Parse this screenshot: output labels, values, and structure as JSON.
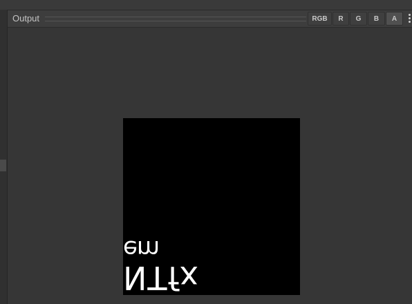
{
  "panel": {
    "title": "Output"
  },
  "channels": [
    {
      "label": "RGB",
      "active": false
    },
    {
      "label": "R",
      "active": false
    },
    {
      "label": "G",
      "active": false
    },
    {
      "label": "B",
      "active": false
    },
    {
      "label": "A",
      "active": true
    }
  ],
  "preview": {
    "text_line_1": "em",
    "text_line_2": "NTfx",
    "background_color": "#000000",
    "text_color": "#ffffff"
  },
  "icons": {
    "menu": "vertical-ellipsis-icon"
  },
  "colors": {
    "panel_bg": "#353535",
    "header_bg": "#3d3d3d",
    "button_bg": "#3f3f3f",
    "button_active_bg": "#505050",
    "text": "#c4c4c4"
  }
}
